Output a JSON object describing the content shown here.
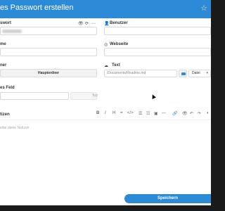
{
  "dialog": {
    "title": "es Passwort erstellen"
  },
  "fields": {
    "password_label": "swort",
    "user_label": "Benutzer",
    "name_label": "me",
    "website_label": "Webseite",
    "folder_label": "ner",
    "folder_button": "Hauptordner",
    "text_label": "Text",
    "text_path_placeholder": "/Documents/Readme.md",
    "text_type_select": "Datei",
    "custom_field_label": "es Feld",
    "custom_type_select": "Typ"
  },
  "notes": {
    "label": "tizen",
    "placeholder": "eibe deine Notizen",
    "toolbar": [
      "B",
      "I",
      "H",
      "❝",
      "</>",
      "☰",
      "☷",
      "▣",
      "—",
      "🔗",
      "👁",
      "↶",
      "↷",
      "◐"
    ]
  },
  "actions": {
    "save_label": "Speichern"
  },
  "icons": {
    "user": "👤",
    "website": "◎",
    "text": "☁",
    "eye": "👁",
    "refresh": "⟳",
    "more": "⋯",
    "star": "☆"
  },
  "colors": {
    "accent": "#2d8ad6",
    "title_text": "#ffffff"
  }
}
